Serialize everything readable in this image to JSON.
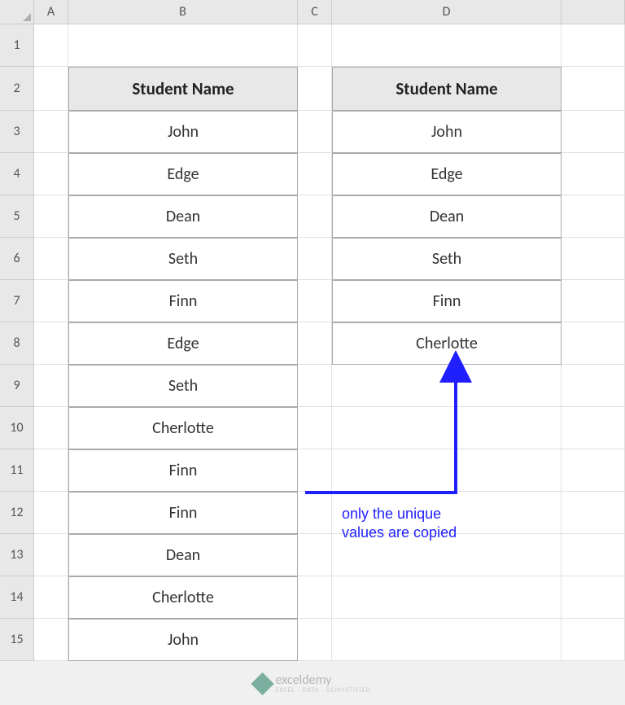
{
  "columns": [
    "A",
    "B",
    "C",
    "D"
  ],
  "rows": [
    "1",
    "2",
    "3",
    "4",
    "5",
    "6",
    "7",
    "8",
    "9",
    "10",
    "11",
    "12",
    "13",
    "14",
    "15"
  ],
  "header_b": "Student Name",
  "header_d": "Student Name",
  "col_b_data": [
    "John",
    "Edge",
    "Dean",
    "Seth",
    "Finn",
    "Edge",
    "Seth",
    "Cherlotte",
    "Finn",
    "Finn",
    "Dean",
    "Cherlotte",
    "John"
  ],
  "col_d_data": [
    "John",
    "Edge",
    "Dean",
    "Seth",
    "Finn",
    "Cherlotte"
  ],
  "annotation": "only the unique\nvalues are copied",
  "watermark": {
    "text": "exceldemy",
    "sub": "EXCEL · DATA · DEMYSTIFIED"
  }
}
